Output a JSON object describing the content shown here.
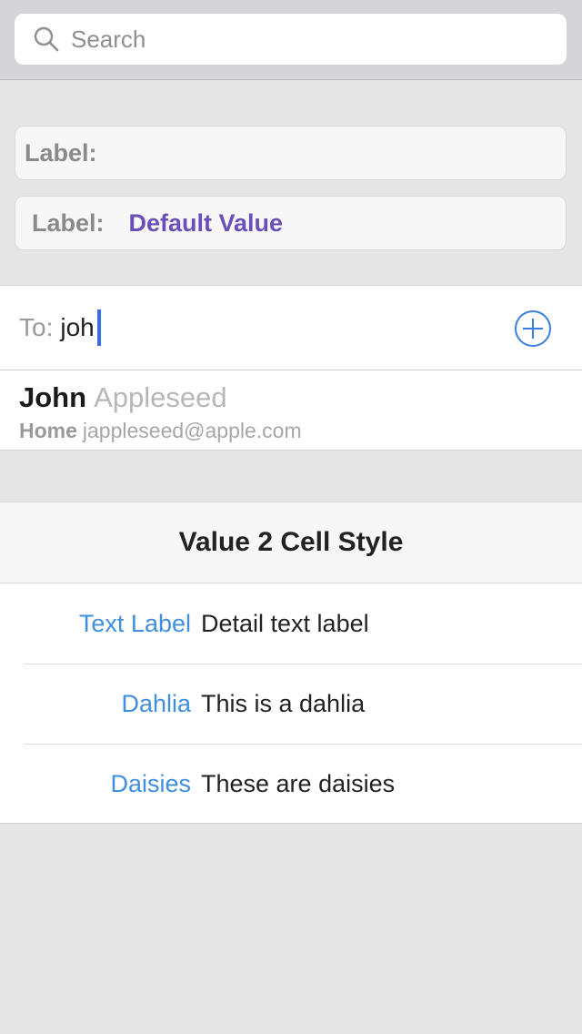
{
  "search": {
    "placeholder": "Search",
    "icon": "search-icon"
  },
  "label_fields": [
    {
      "label": "Label:",
      "value": ""
    },
    {
      "label": "Label:",
      "value": "Default Value"
    }
  ],
  "compose": {
    "to_label": "To:",
    "to_text": "joh",
    "add_icon": "plus-circle-icon"
  },
  "contact": {
    "first_name": "John",
    "last_name": "Appleseed",
    "email_type": "Home",
    "email": "jappleseed@apple.com"
  },
  "section": {
    "title": "Value 2 Cell Style",
    "rows": [
      {
        "label": "Text Label",
        "detail": "Detail text label"
      },
      {
        "label": "Dahlia",
        "detail": "This is a dahlia"
      },
      {
        "label": "Daisies",
        "detail": "These are daisies"
      }
    ]
  },
  "colors": {
    "accent": "#3f8ee0",
    "value_purple": "#6a4fb8",
    "caret": "#3a6ee8"
  }
}
